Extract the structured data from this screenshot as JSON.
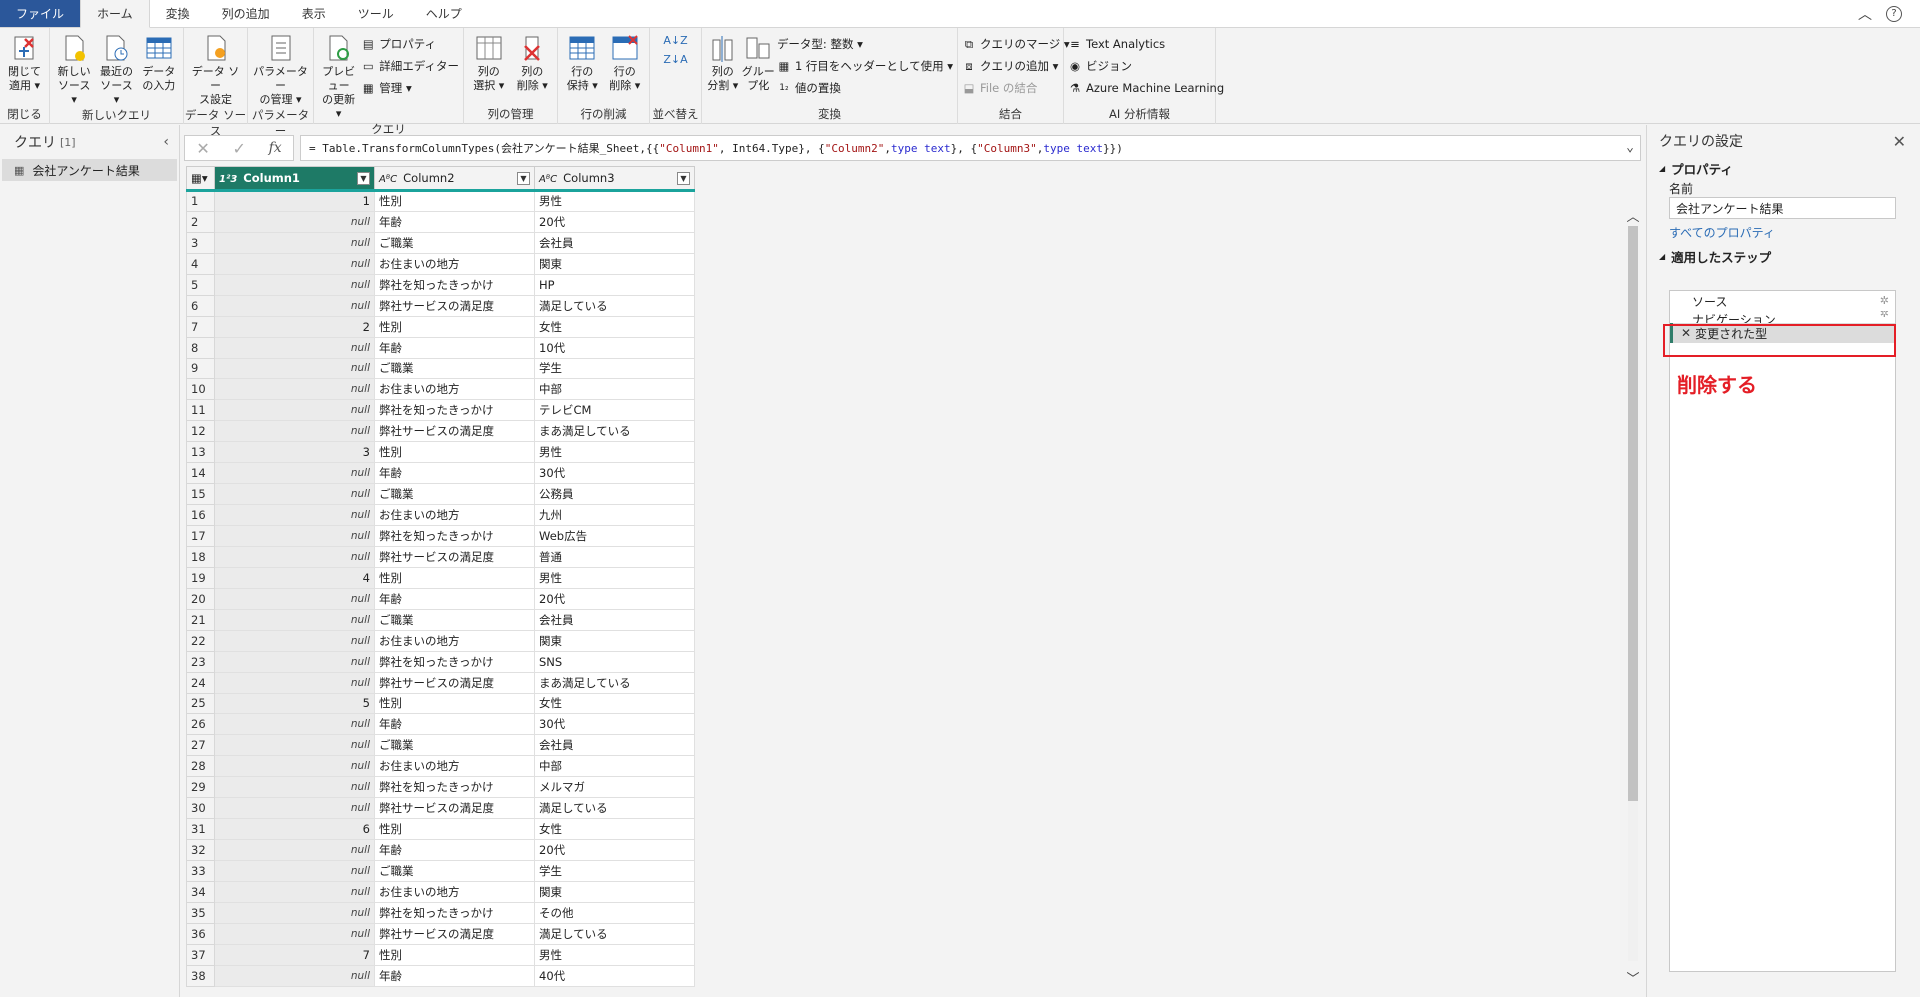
{
  "menu": {
    "tabs": [
      "ファイル",
      "ホーム",
      "変換",
      "列の追加",
      "表示",
      "ツール",
      "ヘルプ"
    ],
    "active": "ホーム",
    "right_icons": [
      "chevron-up-icon",
      "help-icon"
    ]
  },
  "ribbon": {
    "groups": {
      "close": {
        "label": "閉じる",
        "btn": "閉じて\n適用 ▾"
      },
      "new_query": {
        "label": "新しいクエリ",
        "btn1": "新しい\nソース ▾",
        "btn2": "最近の\nソース ▾",
        "btn3": "データ\nの入力"
      },
      "data_source": {
        "label": "データ ソース",
        "btn": "データ ソー\nス設定"
      },
      "parameters": {
        "label": "パラメーター",
        "btn": "パラメーター\nの管理 ▾"
      },
      "query": {
        "label": "クエリ",
        "btn": "プレビュー\nの更新 ▾",
        "s1": "プロパティ",
        "s2": "詳細エディター",
        "s3": "管理 ▾"
      },
      "manage_cols": {
        "label": "列の管理",
        "btn1": "列の\n選択 ▾",
        "btn2": "列の\n削除 ▾"
      },
      "reduce_rows": {
        "label": "行の削減",
        "btn1": "行の\n保持 ▾",
        "btn2": "行の\n削除 ▾"
      },
      "sort": {
        "label": "並べ替え"
      },
      "transform": {
        "label": "変換",
        "btn1": "列の\n分割 ▾",
        "btn2": "グルー\nプ化",
        "s1": "データ型: 整数 ▾",
        "s2": "1 行目をヘッダーとして使用 ▾",
        "s3": "値の置換"
      },
      "combine": {
        "label": "結合",
        "s1": "クエリのマージ ▾",
        "s2": "クエリの追加 ▾",
        "s3": "File の結合"
      },
      "ai": {
        "label": "AI 分析情報",
        "s1": "Text Analytics",
        "s2": "ビジョン",
        "s3": "Azure Machine Learning"
      }
    }
  },
  "queries": {
    "title": "クエリ",
    "count": "[1]",
    "items": [
      "会社アンケート結果"
    ]
  },
  "formula": {
    "prefix": "= Table.TransformColumnTypes(会社アンケート結果_Sheet,{{",
    "s1": "\"Column1\"",
    "m1": ", Int64.Type}, {",
    "s2": "\"Column2\"",
    "m2": ", ",
    "k1": "type text",
    "m3": "}, {",
    "s3": "\"Column3\"",
    "m4": ", ",
    "k2": "type text",
    "end": "}})"
  },
  "grid": {
    "columns": [
      {
        "name": "Column1",
        "type": "1²3"
      },
      {
        "name": "Column2",
        "type": "AᴮC"
      },
      {
        "name": "Column3",
        "type": "AᴮC"
      }
    ],
    "rows": [
      [
        "1",
        "性別",
        "男性"
      ],
      [
        "null",
        "年齢",
        "20代"
      ],
      [
        "null",
        "ご職業",
        "会社員"
      ],
      [
        "null",
        "お住まいの地方",
        "関東"
      ],
      [
        "null",
        "弊社を知ったきっかけ",
        "HP"
      ],
      [
        "null",
        "弊社サービスの満足度",
        "満足している"
      ],
      [
        "2",
        "性別",
        "女性"
      ],
      [
        "null",
        "年齢",
        "10代"
      ],
      [
        "null",
        "ご職業",
        "学生"
      ],
      [
        "null",
        "お住まいの地方",
        "中部"
      ],
      [
        "null",
        "弊社を知ったきっかけ",
        "テレビCM"
      ],
      [
        "null",
        "弊社サービスの満足度",
        "まあ満足している"
      ],
      [
        "3",
        "性別",
        "男性"
      ],
      [
        "null",
        "年齢",
        "30代"
      ],
      [
        "null",
        "ご職業",
        "公務員"
      ],
      [
        "null",
        "お住まいの地方",
        "九州"
      ],
      [
        "null",
        "弊社を知ったきっかけ",
        "Web広告"
      ],
      [
        "null",
        "弊社サービスの満足度",
        "普通"
      ],
      [
        "4",
        "性別",
        "男性"
      ],
      [
        "null",
        "年齢",
        "20代"
      ],
      [
        "null",
        "ご職業",
        "会社員"
      ],
      [
        "null",
        "お住まいの地方",
        "関東"
      ],
      [
        "null",
        "弊社を知ったきっかけ",
        "SNS"
      ],
      [
        "null",
        "弊社サービスの満足度",
        "まあ満足している"
      ],
      [
        "5",
        "性別",
        "女性"
      ],
      [
        "null",
        "年齢",
        "30代"
      ],
      [
        "null",
        "ご職業",
        "会社員"
      ],
      [
        "null",
        "お住まいの地方",
        "中部"
      ],
      [
        "null",
        "弊社を知ったきっかけ",
        "メルマガ"
      ],
      [
        "null",
        "弊社サービスの満足度",
        "満足している"
      ],
      [
        "6",
        "性別",
        "女性"
      ],
      [
        "null",
        "年齢",
        "20代"
      ],
      [
        "null",
        "ご職業",
        "学生"
      ],
      [
        "null",
        "お住まいの地方",
        "関東"
      ],
      [
        "null",
        "弊社を知ったきっかけ",
        "その他"
      ],
      [
        "null",
        "弊社サービスの満足度",
        "満足している"
      ],
      [
        "7",
        "性別",
        "男性"
      ],
      [
        "null",
        "年齢",
        "40代"
      ]
    ]
  },
  "settings": {
    "title": "クエリの設定",
    "properties": "プロパティ",
    "name_label": "名前",
    "name_value": "会社アンケート結果",
    "all_props": "すべてのプロパティ",
    "applied_steps": "適用したステップ",
    "steps": [
      "ソース",
      "ナビゲーション",
      "変更された型"
    ],
    "annotation": "削除する",
    "highlight_color": "#e41e26"
  }
}
